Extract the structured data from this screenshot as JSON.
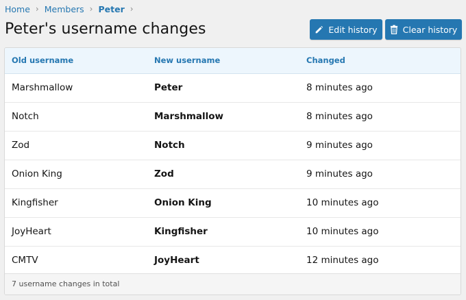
{
  "breadcrumb": {
    "items": [
      "Home",
      "Members",
      "Peter"
    ]
  },
  "page": {
    "title": "Peter's username changes"
  },
  "actions": {
    "edit_label": "Edit history",
    "clear_label": "Clear history"
  },
  "table": {
    "headers": [
      "Old username",
      "New username",
      "Changed"
    ],
    "rows": [
      {
        "old": "Marshmallow",
        "new": "Peter",
        "changed": "8 minutes ago"
      },
      {
        "old": "Notch",
        "new": "Marshmallow",
        "changed": "8 minutes ago"
      },
      {
        "old": "Zod",
        "new": "Notch",
        "changed": "9 minutes ago"
      },
      {
        "old": "Onion King",
        "new": "Zod",
        "changed": "9 minutes ago"
      },
      {
        "old": "Kingfisher",
        "new": "Onion King",
        "changed": "10 minutes ago"
      },
      {
        "old": "JoyHeart",
        "new": "Kingfisher",
        "changed": "10 minutes ago"
      },
      {
        "old": "CMTV",
        "new": "JoyHeart",
        "changed": "12 minutes ago"
      }
    ],
    "footer": "7 username changes in total"
  },
  "colors": {
    "accent": "#2577b1",
    "header_bg": "#edf6fd",
    "page_bg": "#f0f0f0"
  },
  "icons": {
    "edit": "pencil-icon",
    "clear": "trash-icon",
    "separator": "chevron-right-icon"
  }
}
